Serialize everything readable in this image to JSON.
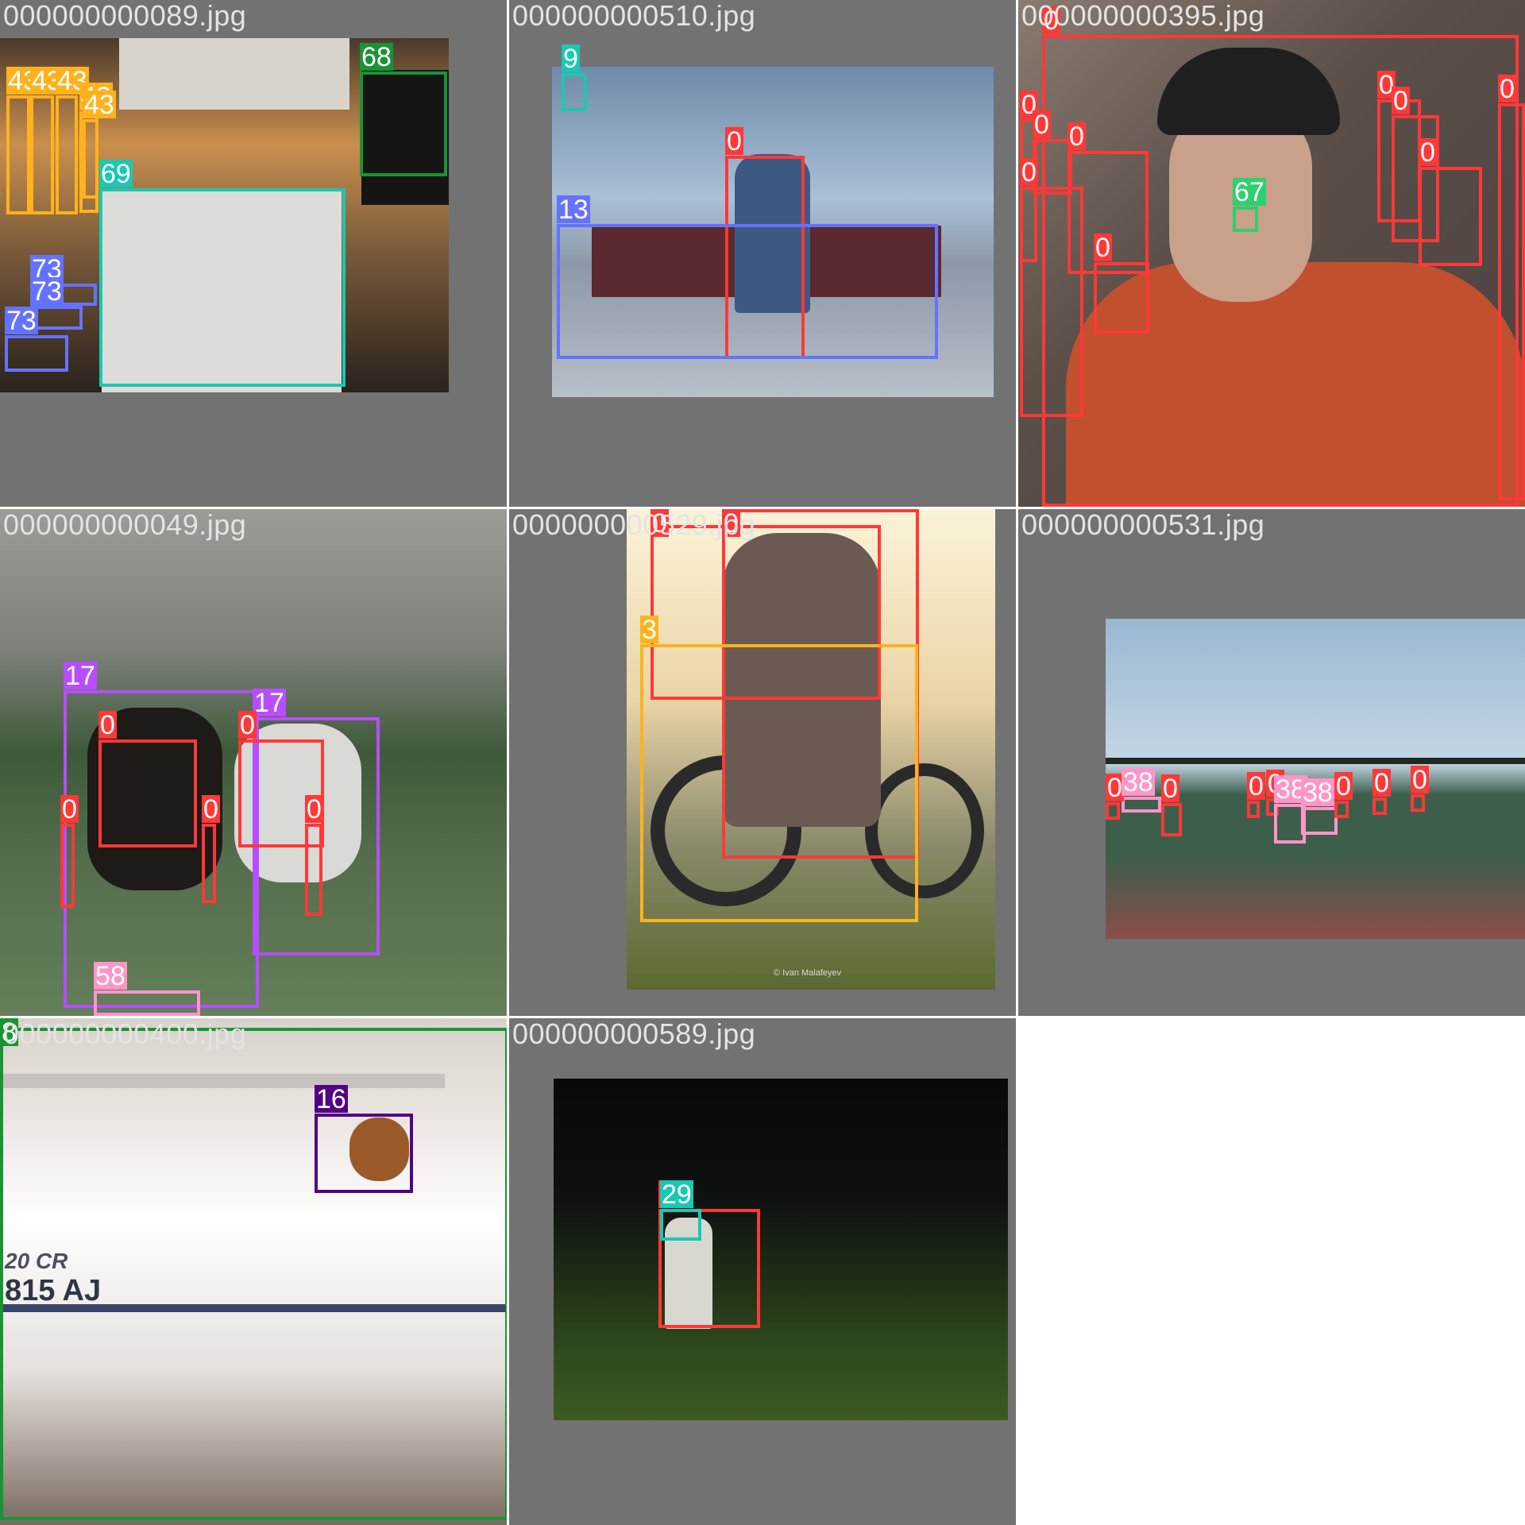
{
  "tiles": [
    {
      "filename": "000000000089.jpg",
      "photo_colors": [
        "#3b2e23",
        "#c98f4e",
        "#7a5a3a"
      ],
      "detections": [
        {
          "label": "43",
          "color": "#ffb21d"
        },
        {
          "label": "43",
          "color": "#ffb21d"
        },
        {
          "label": "43",
          "color": "#ffb21d"
        },
        {
          "label": "43",
          "color": "#ffb21d"
        },
        {
          "label": "43",
          "color": "#ffb21d"
        },
        {
          "label": "68",
          "color": "#1a9334"
        },
        {
          "label": "69",
          "color": "#1ac8b4"
        },
        {
          "label": "73",
          "color": "#6473ff"
        },
        {
          "label": "73",
          "color": "#6473ff"
        },
        {
          "label": "73",
          "color": "#6473ff"
        }
      ]
    },
    {
      "filename": "000000000510.jpg",
      "photo_colors": [
        "#7f9bbd",
        "#5a2a2f",
        "#b5c0cb"
      ],
      "detections": [
        {
          "label": "9",
          "color": "#1ac8b4"
        },
        {
          "label": "0",
          "color": "#ff3838"
        },
        {
          "label": "13",
          "color": "#6473ff"
        }
      ]
    },
    {
      "filename": "000000000395.jpg",
      "photo_colors": [
        "#6f5f55",
        "#c1502f",
        "#1f1f22"
      ],
      "detections": [
        {
          "label": "0",
          "color": "#ff3838"
        },
        {
          "label": "0",
          "color": "#ff3838"
        },
        {
          "label": "0",
          "color": "#ff3838"
        },
        {
          "label": "0",
          "color": "#ff3838"
        },
        {
          "label": "0",
          "color": "#ff3838"
        },
        {
          "label": "0",
          "color": "#ff3838"
        },
        {
          "label": "0",
          "color": "#ff3838"
        },
        {
          "label": "0",
          "color": "#ff3838"
        },
        {
          "label": "0",
          "color": "#ff3838"
        },
        {
          "label": "0",
          "color": "#ff3838"
        },
        {
          "label": "67",
          "color": "#2fcf6f"
        }
      ]
    },
    {
      "filename": "000000000049.jpg",
      "photo_colors": [
        "#8a8d86",
        "#3e5a3a",
        "#5f7d55"
      ],
      "detections": [
        {
          "label": "17",
          "color": "#b84dff"
        },
        {
          "label": "17",
          "color": "#b84dff"
        },
        {
          "label": "0",
          "color": "#ff3838"
        },
        {
          "label": "0",
          "color": "#ff3838"
        },
        {
          "label": "0",
          "color": "#ff3838"
        },
        {
          "label": "0",
          "color": "#ff3838"
        },
        {
          "label": "0",
          "color": "#ff3838"
        },
        {
          "label": "58",
          "color": "#ff95c8"
        }
      ]
    },
    {
      "filename": "000000000529.jpg",
      "photo_colors": [
        "#f2e6c8",
        "#3a3a38",
        "#6f7a3c"
      ],
      "detections": [
        {
          "label": "0",
          "color": "#ff3838"
        },
        {
          "label": "0",
          "color": "#ff3838"
        },
        {
          "label": "3",
          "color": "#ffb21d"
        }
      ],
      "watermark": "© Ivan Malafeyev"
    },
    {
      "filename": "000000000531.jpg",
      "photo_colors": [
        "#a9c2d8",
        "#3e5e4c",
        "#8b4e4a"
      ],
      "detections": [
        {
          "label": "0",
          "color": "#ff3838"
        },
        {
          "label": "38",
          "color": "#ff95c8"
        },
        {
          "label": "0",
          "color": "#ff3838"
        },
        {
          "label": "0",
          "color": "#ff3838"
        },
        {
          "label": "0",
          "color": "#ff3838"
        },
        {
          "label": "38",
          "color": "#ff95c8"
        },
        {
          "label": "38",
          "color": "#ff95c8"
        },
        {
          "label": "0",
          "color": "#ff3838"
        },
        {
          "label": "0",
          "color": "#ff3838"
        },
        {
          "label": "0",
          "color": "#ff3838"
        }
      ]
    },
    {
      "filename": "000000000400.jpg",
      "photo_colors": [
        "#ece6e2",
        "#b9b2ae",
        "#5b4a3f"
      ],
      "detections": [
        {
          "label": "8",
          "color": "#1a9334"
        },
        {
          "label": "16",
          "color": "#520085"
        }
      ],
      "boat_text": [
        "20 CR",
        "815 AJ"
      ]
    },
    {
      "filename": "000000000589.jpg",
      "photo_colors": [
        "#0b0c10",
        "#233a18",
        "#3e5a22"
      ],
      "detections": [
        {
          "label": "0",
          "color": "#ff3838"
        },
        {
          "label": "29",
          "color": "#1ac8b4"
        }
      ]
    }
  ]
}
